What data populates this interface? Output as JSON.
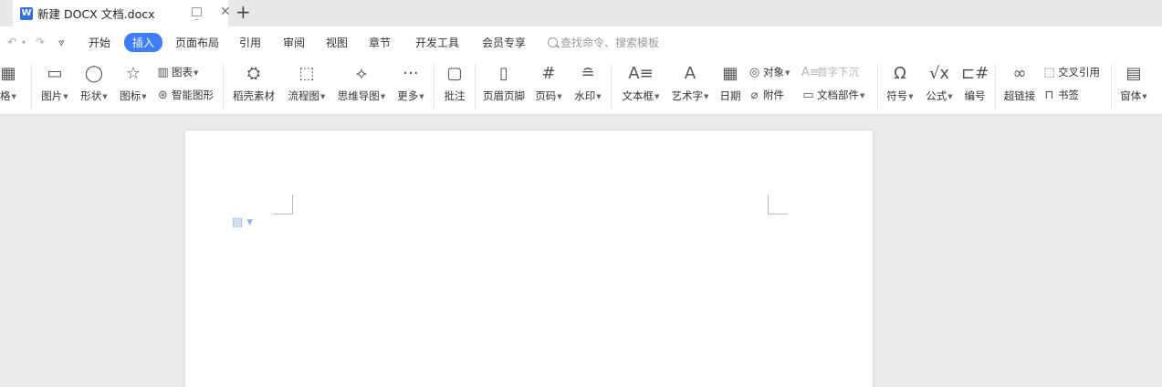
{
  "window": {
    "tab_title": "新建 DOCX 文档.docx",
    "new_tab": "+",
    "close_glyph": "✕",
    "doc_icon": "W"
  },
  "quick_access": {
    "undo": "↶",
    "undo_caret": "▾",
    "redo": "↷",
    "customize": "⩔"
  },
  "menu": {
    "items": [
      "开始",
      "插入",
      "页面布局",
      "引用",
      "审阅",
      "视图",
      "章节",
      "开发工具",
      "会员专享"
    ],
    "active": "插入",
    "search_placeholder": "查找命令、搜索模板"
  },
  "ribbon": {
    "table": "格",
    "picture": "图片",
    "shape": "形状",
    "icons": "图标",
    "chart": "图表",
    "smart_art": "智能图形",
    "material": "稻壳素材",
    "flowchart": "流程图",
    "mindmap": "思维导图",
    "more": "更多",
    "comment": "批注",
    "header_footer": "页眉页脚",
    "page_number": "页码",
    "watermark": "水印",
    "textbox": "文本框",
    "wordart": "艺术字",
    "date": "日期",
    "object": "对象",
    "attachment": "附件",
    "drop_cap": "首字下沉",
    "doc_parts": "文档部件",
    "symbol": "符号",
    "formula": "公式",
    "numbering": "编号",
    "hyperlink": "超链接",
    "cross_ref": "交叉引用",
    "bookmark": "书签",
    "window": "窗体"
  },
  "colors": {
    "accent": "#3e7ef8",
    "page_bg": "#eaeaea"
  }
}
